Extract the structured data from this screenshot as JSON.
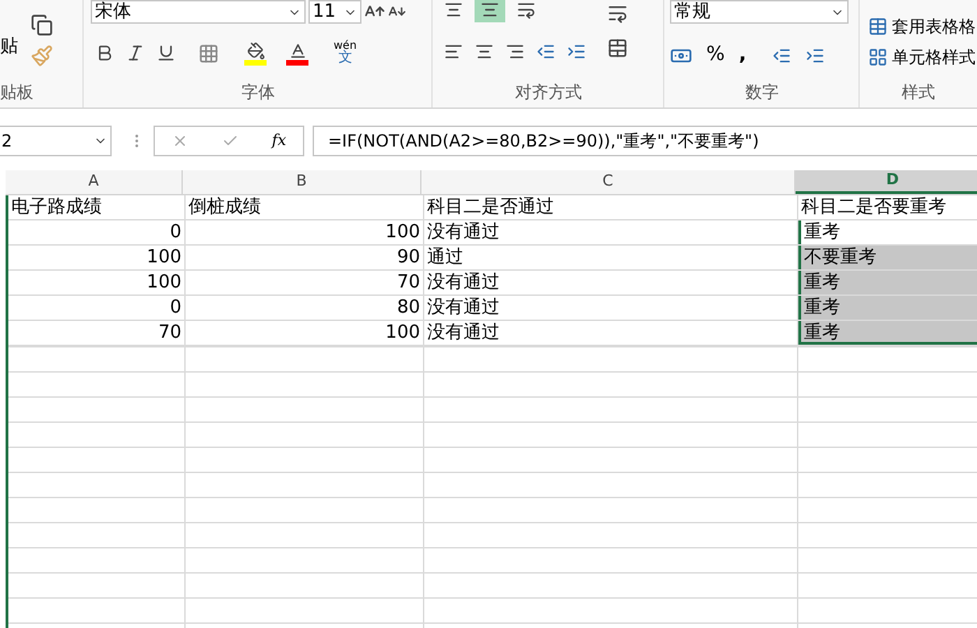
{
  "ribbon": {
    "clipboard": {
      "paste_label": "贴",
      "group_label": "贴板"
    },
    "font": {
      "font_name": "宋体",
      "font_size": "11",
      "phonetic_top": "wén",
      "phonetic_bottom": "文",
      "group_label": "字体"
    },
    "alignment": {
      "group_label": "对齐方式"
    },
    "number": {
      "format": "常规",
      "percent": "%",
      "comma": ",",
      "group_label": "数字"
    },
    "styles": {
      "items": [
        "套用表格格",
        "单元格样式"
      ],
      "group_label": "样式"
    }
  },
  "formula_bar": {
    "name_box": "2",
    "function_label": "fx",
    "formula": "=IF(NOT(AND(A2>=80,B2>=90)),\"重考\",\"不要重考\")"
  },
  "sheet": {
    "columns": [
      {
        "label": "A",
        "selected": false
      },
      {
        "label": "B",
        "selected": false
      },
      {
        "label": "C",
        "selected": false
      },
      {
        "label": "D",
        "selected": true
      }
    ],
    "header": [
      "电子路成绩",
      "倒桩成绩",
      "科目二是否通过",
      "科目二是否要重考"
    ],
    "rows": [
      {
        "cells": [
          "0",
          "100",
          "没有通过"
        ],
        "result": {
          "text": "重考",
          "selected": true,
          "active": true
        }
      },
      {
        "cells": [
          "100",
          "90",
          "通过"
        ],
        "result": {
          "text": "不要重考",
          "selected": true,
          "active": false
        }
      },
      {
        "cells": [
          "100",
          "70",
          "没有通过"
        ],
        "result": {
          "text": "重考",
          "selected": true,
          "active": false
        }
      },
      {
        "cells": [
          "0",
          "80",
          "没有通过"
        ],
        "result": {
          "text": "重考",
          "selected": true,
          "active": false
        }
      },
      {
        "cells": [
          "70",
          "100",
          "没有通过"
        ],
        "result": {
          "text": "重考",
          "selected": true,
          "active": false
        }
      }
    ]
  }
}
